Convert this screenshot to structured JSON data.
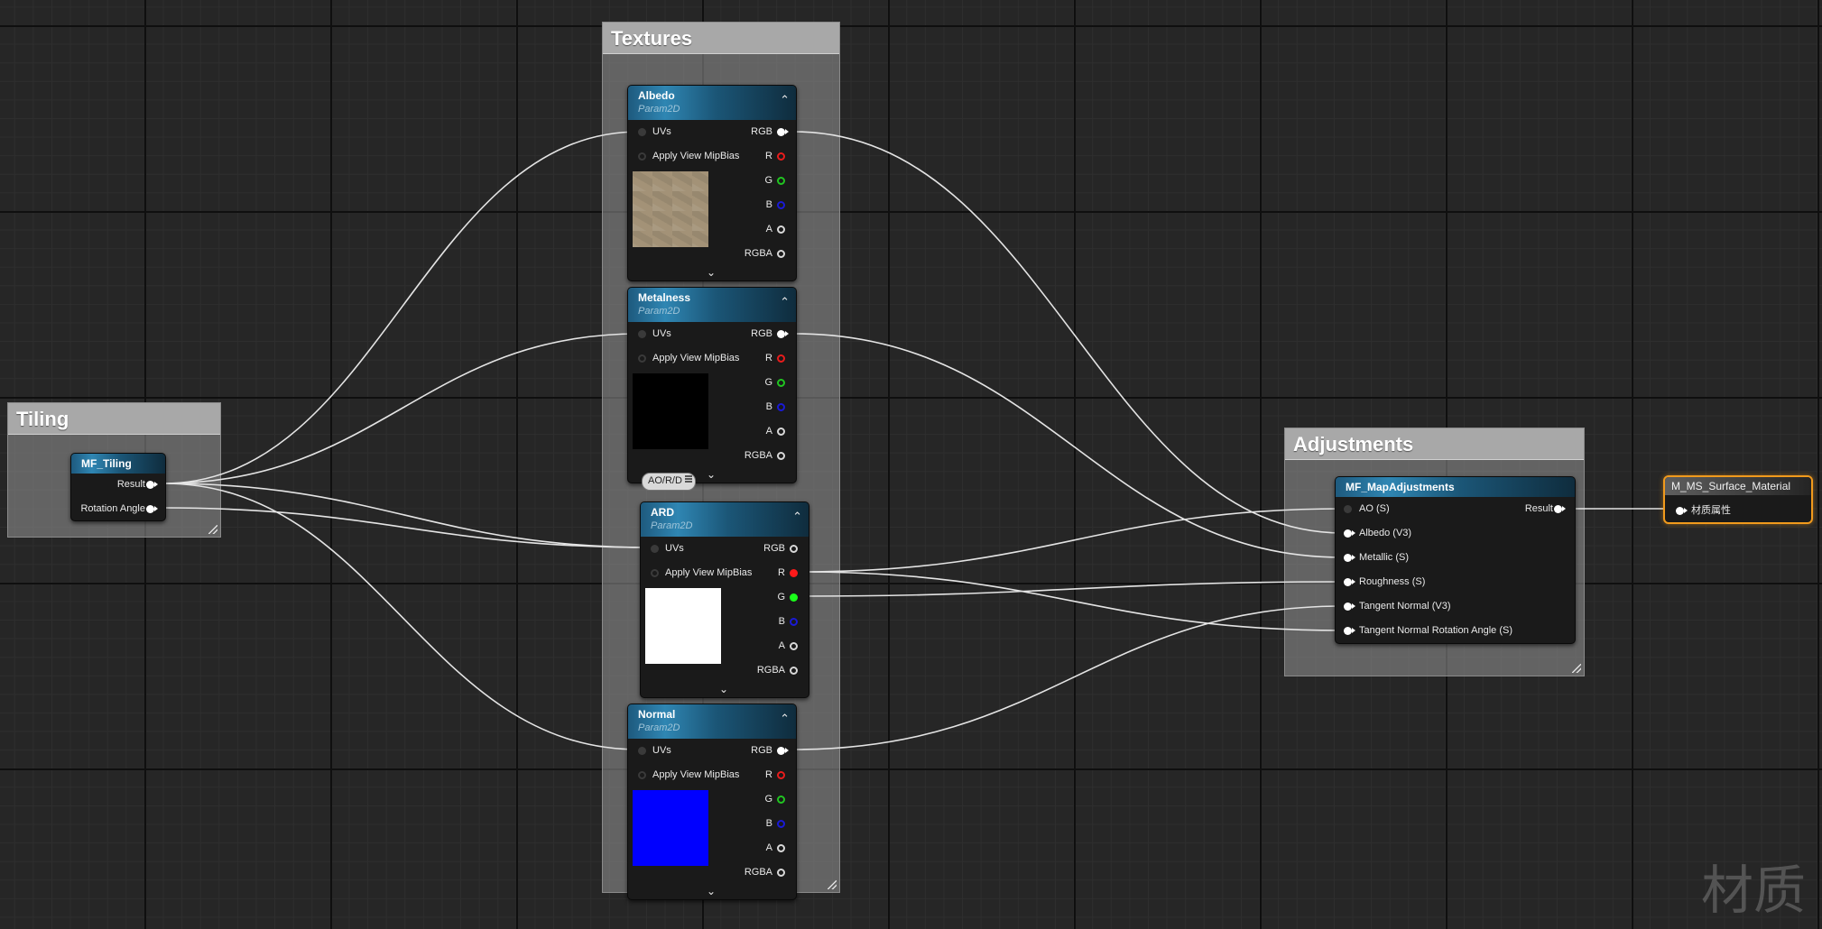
{
  "comments": {
    "textures": "Textures",
    "tiling": "Tiling",
    "adjustments": "Adjustments"
  },
  "texture_nodes": {
    "albedo": {
      "title": "Albedo",
      "subtitle": "Param2D"
    },
    "metalness": {
      "title": "Metalness",
      "subtitle": "Param2D"
    },
    "ard": {
      "title": "ARD",
      "subtitle": "Param2D"
    },
    "normal": {
      "title": "Normal",
      "subtitle": "Param2D"
    }
  },
  "texture_pins": {
    "uvs": "UVs",
    "mipbias": "Apply View MipBias",
    "rgb": "RGB",
    "r": "R",
    "g": "G",
    "b": "B",
    "a": "A",
    "rgba": "RGBA"
  },
  "tiling_node": {
    "title": "MF_Tiling",
    "result": "Result",
    "rotation": "Rotation Angle"
  },
  "reroute_tag": "AO/R/D",
  "adjust_node": {
    "title": "MF_MapAdjustments",
    "inputs": [
      "AO (S)",
      "Albedo (V3)",
      "Metallic (S)",
      "Roughness (S)",
      "Tangent Normal (V3)",
      "Tangent Normal Rotation Angle (S)"
    ],
    "result": "Result"
  },
  "output_node": {
    "title": "M_MS_Surface_Material",
    "pin": "材质属性"
  },
  "watermark": "材质",
  "colors": {
    "preview_albedo": "#a39277",
    "preview_metalness": "#000000",
    "preview_ard": "#ffffff",
    "preview_normal": "#0000ff",
    "output_border": "#f19a1c"
  }
}
